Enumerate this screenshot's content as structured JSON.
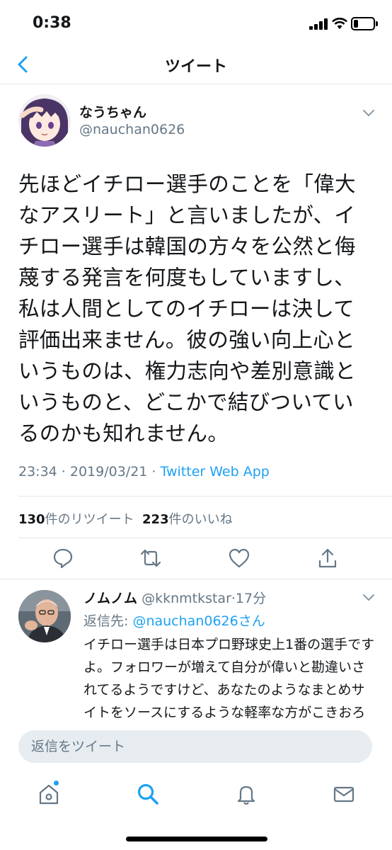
{
  "status_bar": {
    "time": "0:38"
  },
  "header": {
    "title": "ツイート"
  },
  "tweet": {
    "author_name": "なうちゃん",
    "author_handle": "@nauchan0626",
    "text_lines": [
      "先ほどイチロー選手のことを「偉大",
      "なアスリート」と言いましたが、イ",
      "チロー選手は韓国の方々を公然と侮",
      "蔑する発言を何度もしていますし、",
      "私は人間としてのイチローは決して",
      "評価出来ません。彼の強い向上心と",
      "いうものは、権力志向や差別意識と",
      "いうものと、どこかで結びついてい",
      "るのかも知れません。"
    ],
    "timestamp": "23:34 · 2019/03/21 · ",
    "source": "Twitter Web App",
    "retweet_count": "130",
    "retweet_label": "件のリツイート",
    "like_count": "223",
    "like_label": "件のいいね"
  },
  "actions": [
    {
      "icon": "reply-icon"
    },
    {
      "icon": "retweet-icon"
    },
    {
      "icon": "like-icon"
    },
    {
      "icon": "share-icon"
    }
  ],
  "reply": {
    "author_name": "ノムノム",
    "author_handle": "@kknmtkstar",
    "time": "·17分",
    "reply_prefix": "返信先: ",
    "reply_target": "@nauchan0626さん",
    "text": "イチロー選手は日本プロ野球史上1番の選手ですよ。フォロワーが増えて自分が偉いと勘違いされてるようですけど、あなたのようなまとめサイトをソースにするような軽率な方がこきおろせるような相手でないことだけは確"
  },
  "compose": {
    "placeholder": "返信をツイート"
  },
  "tabbar": [
    {
      "icon": "home-icon"
    },
    {
      "icon": "search-icon"
    },
    {
      "icon": "notifications-icon"
    },
    {
      "icon": "messages-icon"
    }
  ],
  "colors": {
    "accent": "#1da1f2",
    "secondary_text": "#657786",
    "divider": "#e1e8ed"
  }
}
